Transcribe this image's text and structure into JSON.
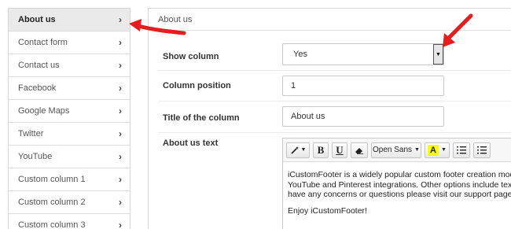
{
  "sidebar": {
    "items": [
      {
        "label": "About us",
        "active": true
      },
      {
        "label": "Contact form"
      },
      {
        "label": "Contact us"
      },
      {
        "label": "Facebook"
      },
      {
        "label": "Google Maps"
      },
      {
        "label": "Twitter"
      },
      {
        "label": "YouTube"
      },
      {
        "label": "Custom column 1"
      },
      {
        "label": "Custom column 2"
      },
      {
        "label": "Custom column 3"
      }
    ]
  },
  "panel": {
    "title": "About us",
    "show_column": {
      "label": "Show column",
      "value": "Yes"
    },
    "column_position": {
      "label": "Column position",
      "value": "1"
    },
    "column_title": {
      "label": "Title of the column",
      "value": "About us"
    },
    "about_text": {
      "label": "About us text"
    }
  },
  "editor": {
    "font_label": "Open Sans",
    "color_letter": "A",
    "paragraph1_line1": "iCustomFooter is a widely popular custom footer creation modul",
    "paragraph1_line2": "YouTube and Pinterest integrations. Other options include text ed",
    "paragraph1_line3": "have any concerns or questions please visit our support page fro",
    "paragraph2": "Enjoy iCustomFooter!"
  },
  "colors": {
    "arrow": "#e81c1c",
    "highlight": "#ffff00",
    "sidebar_active_bg": "#eaeaea"
  }
}
